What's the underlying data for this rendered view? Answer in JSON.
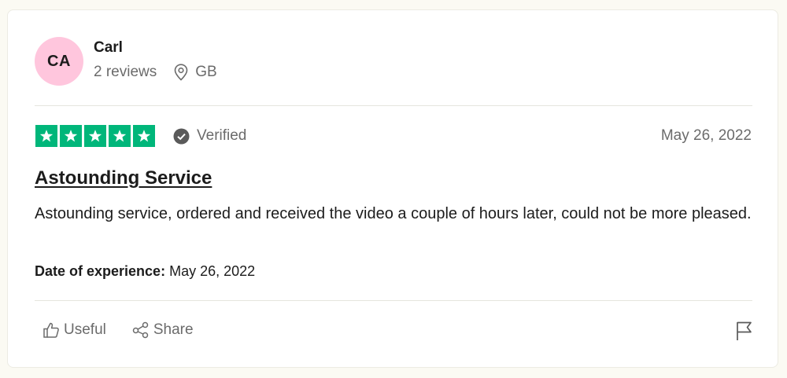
{
  "reviewer": {
    "initials": "CA",
    "name": "Carl",
    "reviews": "2 reviews",
    "country": "GB",
    "avatar_color": "#ffc6dd"
  },
  "rating": {
    "stars": 5,
    "star_color": "#00b67a",
    "verified_label": "Verified",
    "date": "May 26, 2022"
  },
  "review": {
    "title": "Astounding Service",
    "text": "Astounding service, ordered and received the video a couple of hours later, could not be more pleased.",
    "experience_label": "Date of experience:",
    "experience_date": "May 26, 2022"
  },
  "actions": {
    "useful_label": "Useful",
    "share_label": "Share",
    "flag_icon": "flag-icon"
  }
}
